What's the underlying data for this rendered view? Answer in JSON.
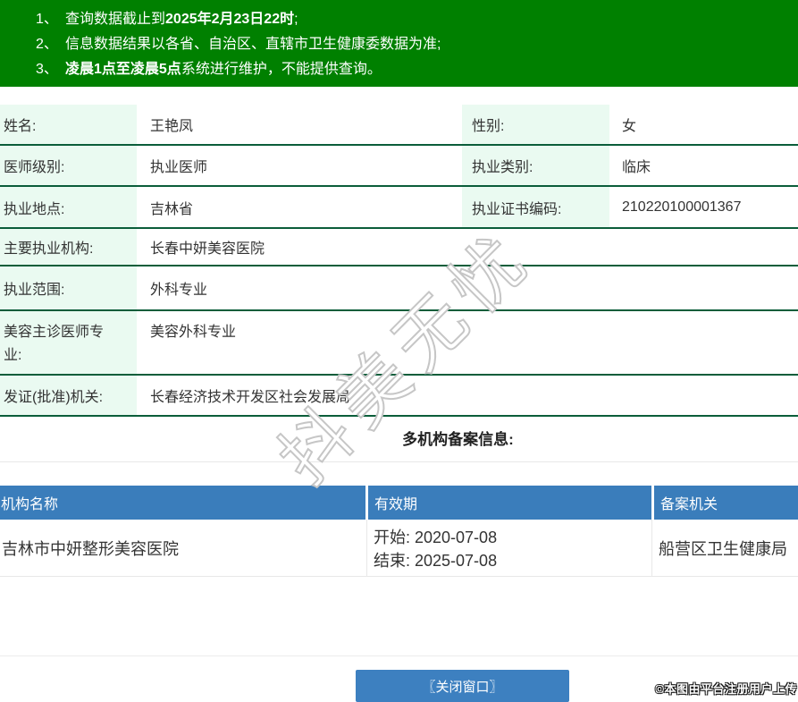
{
  "notices": {
    "items": [
      {
        "num": "1、",
        "pre": "查询数据截止到",
        "bold": "2025年2月23日22时",
        "post": ";"
      },
      {
        "num": "2、",
        "pre": "信息数据结果以各省、自治区、直辖市卫生健康委数据为准;",
        "bold": "",
        "post": ""
      },
      {
        "num": "3、",
        "pre": "",
        "bold": "凌晨1点至凌晨5点",
        "post": "系统进行维护，不能提供查询。"
      }
    ]
  },
  "info_table": {
    "rows": [
      {
        "label": "姓名:",
        "value": "王艳凤",
        "label2": "性别:",
        "value2": "女"
      },
      {
        "label": "医师级别:",
        "value": "执业医师",
        "label2": "执业类别:",
        "value2": "临床"
      },
      {
        "label": "执业地点:",
        "value": "吉林省",
        "label2": "执业证书编码:",
        "value2": "210220100001367"
      },
      {
        "label": "主要执业机构:",
        "value": "长春中妍美容医院"
      },
      {
        "label": "执业范围:",
        "value": "外科专业"
      },
      {
        "label": "美容主诊医师专业:",
        "value": "美容外科专业"
      },
      {
        "label": "发证(批准)机关:",
        "value": "长春经济技术开发区社会发展局"
      }
    ]
  },
  "section": {
    "filing_title": "多机构备案信息:"
  },
  "filing_table": {
    "headers": [
      "机构名称",
      "有效期",
      "备案机关"
    ],
    "rows": [
      {
        "org": "吉林市中妍整形美容医院",
        "validity_start": "开始: 2020-07-08",
        "validity_end": "结束: 2025-07-08",
        "authority": "船营区卫生健康局"
      }
    ]
  },
  "footer": {
    "close_button": "〖关闭窗口〗",
    "stamp": "©本图由平台注册用户上传"
  },
  "watermark": {
    "text": "抖美无忧"
  },
  "colors": {
    "banner_green": "#008000",
    "row_border_green": "#0b5d3a",
    "label_mint": "#eafaf1",
    "table_header_blue": "#3a7dbb",
    "button_blue": "#3d80c0",
    "light_divider": "#e8e8e8"
  }
}
